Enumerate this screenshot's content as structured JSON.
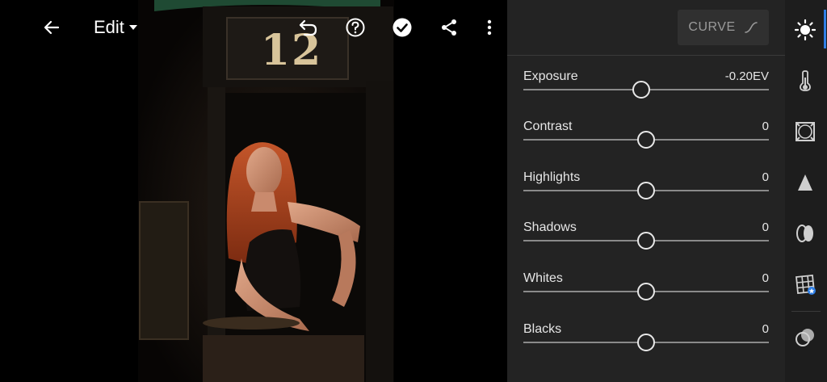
{
  "topbar": {
    "edit_label": "Edit"
  },
  "photo": {
    "sign_text": "12"
  },
  "panel": {
    "curve_label": "CURVE",
    "sliders": [
      {
        "label": "Exposure",
        "value_text": "-0.20EV",
        "position": 0.48
      },
      {
        "label": "Contrast",
        "value_text": "0",
        "position": 0.5
      },
      {
        "label": "Highlights",
        "value_text": "0",
        "position": 0.5
      },
      {
        "label": "Shadows",
        "value_text": "0",
        "position": 0.5
      },
      {
        "label": "Whites",
        "value_text": "0",
        "position": 0.5
      },
      {
        "label": "Blacks",
        "value_text": "0",
        "position": 0.5
      }
    ]
  },
  "strip": {
    "items": [
      "light-icon",
      "color-icon",
      "effects-icon",
      "detail-icon",
      "optics-icon",
      "geometry-icon",
      "presets-icon"
    ],
    "active_index": 0
  },
  "colors": {
    "panel_bg": "#232323",
    "accent": "#2f7fe6"
  }
}
